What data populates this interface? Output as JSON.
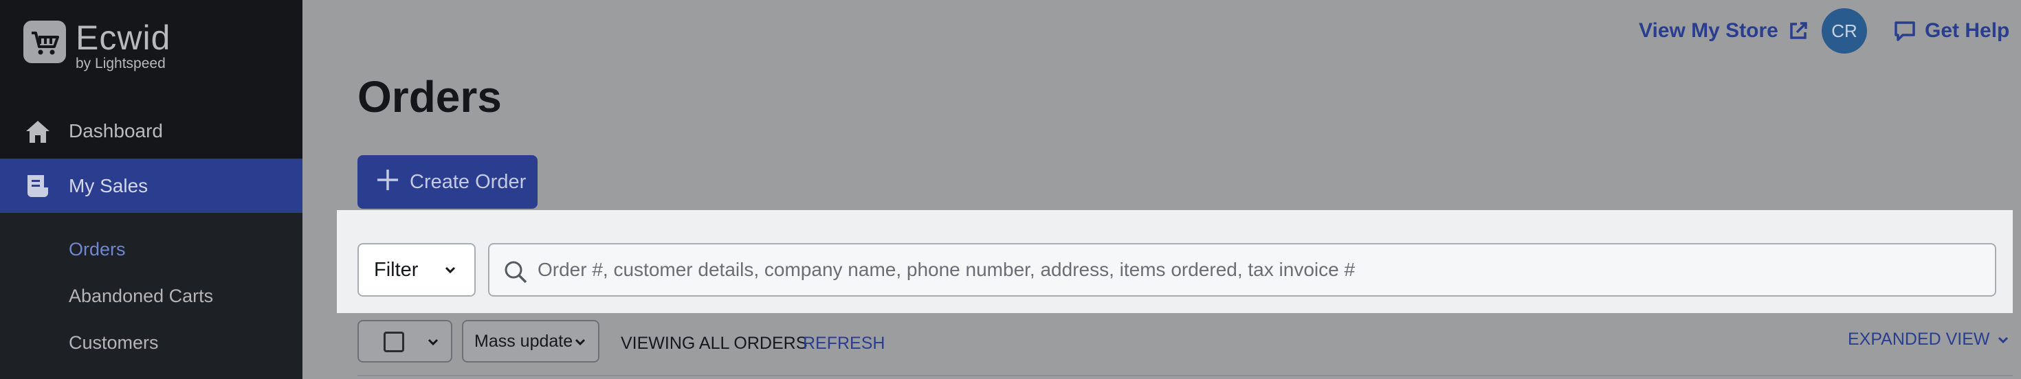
{
  "brand": {
    "name": "Ecwid",
    "sub": "by Lightspeed"
  },
  "sidebar": {
    "items": [
      {
        "label": "Dashboard",
        "icon": "home-icon"
      },
      {
        "label": "My Sales",
        "icon": "sales-icon",
        "active": true
      }
    ],
    "subitems": [
      {
        "label": "Orders",
        "active": true
      },
      {
        "label": "Abandoned Carts"
      },
      {
        "label": "Customers"
      }
    ]
  },
  "topbar": {
    "view_store": "View My Store",
    "avatar": "CR",
    "get_help": "Get Help"
  },
  "page": {
    "title": "Orders"
  },
  "actions": {
    "create_order": "Create Order"
  },
  "filter": {
    "label": "Filter",
    "search_placeholder": "Order #, customer details, company name, phone number, address, items ordered, tax invoice #"
  },
  "toolbar": {
    "mass_update": "Mass update",
    "viewing": "VIEWING ALL ORDERS",
    "refresh": "REFRESH",
    "expanded_view": "EXPANDED VIEW"
  },
  "colors": {
    "sidebar_bg": "#14161a",
    "accent": "#2b3d8f",
    "link": "#2a3e90",
    "avatar_bg": "#2a5b8e"
  }
}
